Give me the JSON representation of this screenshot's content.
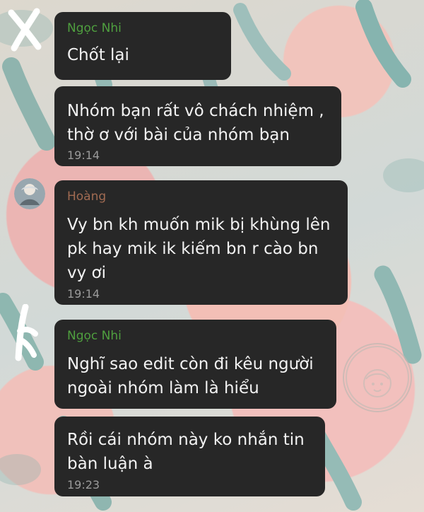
{
  "chat": {
    "messages": [
      {
        "sender": "Ngọc Nhi",
        "lines": [
          "Chốt lại"
        ],
        "time": ""
      },
      {
        "sender": "",
        "lines": [
          "Nhóm bạn rất vô chách nhiệm ,",
          "thờ ơ với bài của nhóm bạn"
        ],
        "time": "19:14"
      },
      {
        "sender": "Hoàng",
        "lines": [
          "Vy bn kh muốn mik bị khùng lên",
          "pk hay mik ik kiếm bn r cào bn",
          "vy ơi"
        ],
        "time": "19:14"
      },
      {
        "sender": "Ngọc Nhi",
        "lines": [
          "Nghĩ sao edit còn đi kêu người",
          "ngoài nhóm làm là hiểu"
        ],
        "time": ""
      },
      {
        "sender": "",
        "lines": [
          "Rồi cái nhóm này ko nhắn tin",
          "bàn luận à"
        ],
        "time": "19:23"
      }
    ]
  },
  "colors": {
    "bubble": "#272727",
    "bubble_text": "#f2f2f2",
    "sender_green": "#4f9f3f",
    "sender_brown": "#a16b52",
    "timestamp": "#9b9b9b"
  }
}
